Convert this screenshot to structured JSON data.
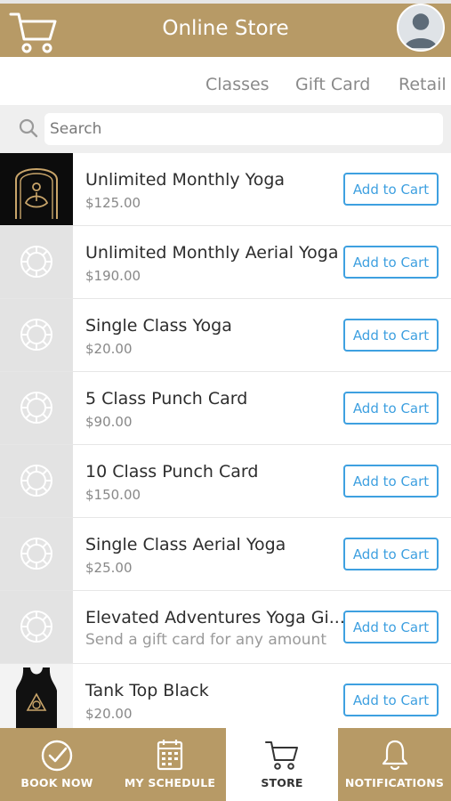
{
  "header": {
    "title": "Online Store",
    "cart_icon": "shopping-cart-icon",
    "avatar_icon": "user-avatar-icon"
  },
  "tabs": [
    "Classes",
    "Gift Card",
    "Retail"
  ],
  "search": {
    "placeholder": "Search",
    "value": ""
  },
  "button_label": "Add to Cart",
  "items": [
    {
      "name": "Unlimited Monthly Yoga",
      "price": "$125.00",
      "thumb": "yoga-logo"
    },
    {
      "name": "Unlimited Monthly Aerial Yoga",
      "price": "$190.00",
      "thumb": "placeholder-lotus"
    },
    {
      "name": "Single Class Yoga",
      "price": "$20.00",
      "thumb": "placeholder-lotus"
    },
    {
      "name": "5 Class Punch Card",
      "price": "$90.00",
      "thumb": "placeholder-lotus"
    },
    {
      "name": "10 Class Punch Card",
      "price": "$150.00",
      "thumb": "placeholder-lotus"
    },
    {
      "name": "Single Class Aerial Yoga",
      "price": "$25.00",
      "thumb": "placeholder-lotus"
    },
    {
      "name": "Elevated Adventures Yoga Gi...",
      "subtitle": "Send a gift card for any amount",
      "thumb": "placeholder-lotus"
    },
    {
      "name": "Tank Top Black",
      "price": "$20.00",
      "thumb": "tank-top-photo"
    }
  ],
  "bottom_nav": [
    {
      "label": "BOOK NOW",
      "icon": "check-circle-icon"
    },
    {
      "label": "MY SCHEDULE",
      "icon": "calendar-icon"
    },
    {
      "label": "STORE",
      "icon": "shopping-cart-icon",
      "active": true
    },
    {
      "label": "NOTIFICATIONS",
      "icon": "bell-icon"
    }
  ],
  "colors": {
    "brand": "#b79a66",
    "accent": "#3ea0e0"
  }
}
